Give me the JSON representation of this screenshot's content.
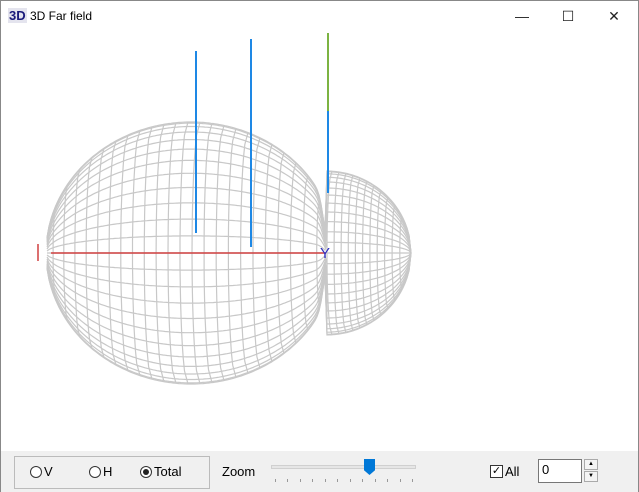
{
  "window": {
    "icon_text": "3D",
    "title": "3D Far field",
    "minimize": "—",
    "maximize": "☐",
    "close": "✕"
  },
  "view": {
    "axis_label": "Y",
    "colors": {
      "mesh": "#c8c8c8",
      "beam": "#1e88e5",
      "axis": "#d04040",
      "label": "#3030c0"
    }
  },
  "controls": {
    "radios": [
      {
        "label": "V",
        "checked": false
      },
      {
        "label": "H",
        "checked": false
      },
      {
        "label": "Total",
        "checked": true
      }
    ],
    "zoom_label": "Zoom",
    "zoom_value_fraction": 0.68,
    "all_label": "All",
    "all_checked": true,
    "checkmark": "✓",
    "number_value": "0",
    "spin_up": "▲",
    "spin_down": "▼"
  }
}
